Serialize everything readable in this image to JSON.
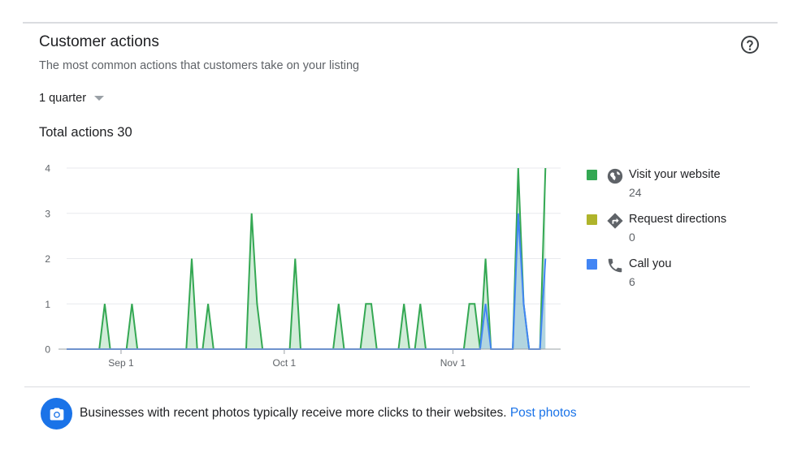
{
  "card": {
    "title": "Customer actions",
    "subtitle": "The most common actions that customers take on your listing",
    "help_icon": "help-circle-icon"
  },
  "period_selector": {
    "selected": "1 quarter",
    "icon": "caret-down-icon"
  },
  "total": {
    "text": "Total actions 30"
  },
  "colors": {
    "website": "#34a853",
    "directions": "#afb42b",
    "calls": "#4285f4",
    "text_secondary": "#5f6368",
    "link": "#1a73e8"
  },
  "legend": [
    {
      "label": "Visit your website",
      "value": "24",
      "color": "#34a853",
      "icon": "globe-icon"
    },
    {
      "label": "Request directions",
      "value": "0",
      "color": "#afb42b",
      "icon": "directions-icon"
    },
    {
      "label": "Call you",
      "value": "6",
      "color": "#4285f4",
      "icon": "phone-icon"
    }
  ],
  "chart_data": {
    "type": "area",
    "x_start": "2018-08-22",
    "x_end": "2018-11-19",
    "x_ticks": [
      "Sep 1",
      "Oct 1",
      "Nov 1"
    ],
    "x_tick_dates": [
      "2018-09-01",
      "2018-10-01",
      "2018-11-01"
    ],
    "ylim": [
      0,
      4
    ],
    "y_ticks": [
      0,
      1,
      2,
      3,
      4
    ],
    "grid": true,
    "legend_position": "right",
    "series": [
      {
        "name": "Visit your website",
        "color": "#34a853",
        "points": [
          [
            "2018-08-22",
            0
          ],
          [
            "2018-08-28",
            0
          ],
          [
            "2018-08-29",
            1
          ],
          [
            "2018-08-30",
            0
          ],
          [
            "2018-09-02",
            0
          ],
          [
            "2018-09-03",
            1
          ],
          [
            "2018-09-04",
            0
          ],
          [
            "2018-09-13",
            0
          ],
          [
            "2018-09-14",
            2
          ],
          [
            "2018-09-15",
            0
          ],
          [
            "2018-09-16",
            0
          ],
          [
            "2018-09-17",
            1
          ],
          [
            "2018-09-18",
            0
          ],
          [
            "2018-09-24",
            0
          ],
          [
            "2018-09-25",
            3
          ],
          [
            "2018-09-26",
            1
          ],
          [
            "2018-09-27",
            0
          ],
          [
            "2018-10-02",
            0
          ],
          [
            "2018-10-03",
            2
          ],
          [
            "2018-10-04",
            0
          ],
          [
            "2018-10-10",
            0
          ],
          [
            "2018-10-11",
            1
          ],
          [
            "2018-10-12",
            0
          ],
          [
            "2018-10-15",
            0
          ],
          [
            "2018-10-16",
            1
          ],
          [
            "2018-10-17",
            1
          ],
          [
            "2018-10-18",
            0
          ],
          [
            "2018-10-22",
            0
          ],
          [
            "2018-10-23",
            1
          ],
          [
            "2018-10-24",
            0
          ],
          [
            "2018-10-25",
            0
          ],
          [
            "2018-10-26",
            1
          ],
          [
            "2018-10-27",
            0
          ],
          [
            "2018-11-03",
            0
          ],
          [
            "2018-11-04",
            1
          ],
          [
            "2018-11-05",
            1
          ],
          [
            "2018-11-06",
            0
          ],
          [
            "2018-11-07",
            2
          ],
          [
            "2018-11-08",
            0
          ],
          [
            "2018-11-12",
            0
          ],
          [
            "2018-11-13",
            4
          ],
          [
            "2018-11-14",
            1
          ],
          [
            "2018-11-15",
            0
          ],
          [
            "2018-11-17",
            0
          ],
          [
            "2018-11-18",
            4
          ]
        ]
      },
      {
        "name": "Call you",
        "color": "#4285f4",
        "points": [
          [
            "2018-08-22",
            0
          ],
          [
            "2018-11-06",
            0
          ],
          [
            "2018-11-07",
            1
          ],
          [
            "2018-11-08",
            0
          ],
          [
            "2018-11-12",
            0
          ],
          [
            "2018-11-13",
            3
          ],
          [
            "2018-11-14",
            1
          ],
          [
            "2018-11-15",
            0
          ],
          [
            "2018-11-17",
            0
          ],
          [
            "2018-11-18",
            2
          ]
        ]
      }
    ]
  },
  "tip": {
    "icon": "camera-icon",
    "text": "Businesses with recent photos typically receive more clicks to their websites.",
    "link": "Post photos"
  }
}
